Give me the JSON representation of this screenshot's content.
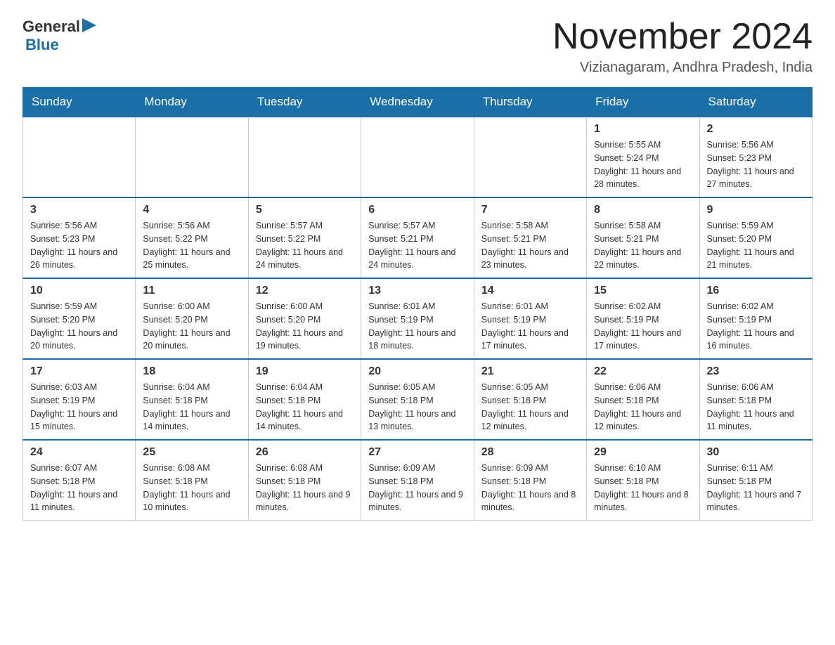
{
  "header": {
    "logo": {
      "general": "General",
      "blue": "Blue"
    },
    "title": "November 2024",
    "location": "Vizianagaram, Andhra Pradesh, India"
  },
  "weekdays": [
    "Sunday",
    "Monday",
    "Tuesday",
    "Wednesday",
    "Thursday",
    "Friday",
    "Saturday"
  ],
  "weeks": [
    [
      {
        "day": "",
        "info": ""
      },
      {
        "day": "",
        "info": ""
      },
      {
        "day": "",
        "info": ""
      },
      {
        "day": "",
        "info": ""
      },
      {
        "day": "",
        "info": ""
      },
      {
        "day": "1",
        "info": "Sunrise: 5:55 AM\nSunset: 5:24 PM\nDaylight: 11 hours and 28 minutes."
      },
      {
        "day": "2",
        "info": "Sunrise: 5:56 AM\nSunset: 5:23 PM\nDaylight: 11 hours and 27 minutes."
      }
    ],
    [
      {
        "day": "3",
        "info": "Sunrise: 5:56 AM\nSunset: 5:23 PM\nDaylight: 11 hours and 26 minutes."
      },
      {
        "day": "4",
        "info": "Sunrise: 5:56 AM\nSunset: 5:22 PM\nDaylight: 11 hours and 25 minutes."
      },
      {
        "day": "5",
        "info": "Sunrise: 5:57 AM\nSunset: 5:22 PM\nDaylight: 11 hours and 24 minutes."
      },
      {
        "day": "6",
        "info": "Sunrise: 5:57 AM\nSunset: 5:21 PM\nDaylight: 11 hours and 24 minutes."
      },
      {
        "day": "7",
        "info": "Sunrise: 5:58 AM\nSunset: 5:21 PM\nDaylight: 11 hours and 23 minutes."
      },
      {
        "day": "8",
        "info": "Sunrise: 5:58 AM\nSunset: 5:21 PM\nDaylight: 11 hours and 22 minutes."
      },
      {
        "day": "9",
        "info": "Sunrise: 5:59 AM\nSunset: 5:20 PM\nDaylight: 11 hours and 21 minutes."
      }
    ],
    [
      {
        "day": "10",
        "info": "Sunrise: 5:59 AM\nSunset: 5:20 PM\nDaylight: 11 hours and 20 minutes."
      },
      {
        "day": "11",
        "info": "Sunrise: 6:00 AM\nSunset: 5:20 PM\nDaylight: 11 hours and 20 minutes."
      },
      {
        "day": "12",
        "info": "Sunrise: 6:00 AM\nSunset: 5:20 PM\nDaylight: 11 hours and 19 minutes."
      },
      {
        "day": "13",
        "info": "Sunrise: 6:01 AM\nSunset: 5:19 PM\nDaylight: 11 hours and 18 minutes."
      },
      {
        "day": "14",
        "info": "Sunrise: 6:01 AM\nSunset: 5:19 PM\nDaylight: 11 hours and 17 minutes."
      },
      {
        "day": "15",
        "info": "Sunrise: 6:02 AM\nSunset: 5:19 PM\nDaylight: 11 hours and 17 minutes."
      },
      {
        "day": "16",
        "info": "Sunrise: 6:02 AM\nSunset: 5:19 PM\nDaylight: 11 hours and 16 minutes."
      }
    ],
    [
      {
        "day": "17",
        "info": "Sunrise: 6:03 AM\nSunset: 5:19 PM\nDaylight: 11 hours and 15 minutes."
      },
      {
        "day": "18",
        "info": "Sunrise: 6:04 AM\nSunset: 5:18 PM\nDaylight: 11 hours and 14 minutes."
      },
      {
        "day": "19",
        "info": "Sunrise: 6:04 AM\nSunset: 5:18 PM\nDaylight: 11 hours and 14 minutes."
      },
      {
        "day": "20",
        "info": "Sunrise: 6:05 AM\nSunset: 5:18 PM\nDaylight: 11 hours and 13 minutes."
      },
      {
        "day": "21",
        "info": "Sunrise: 6:05 AM\nSunset: 5:18 PM\nDaylight: 11 hours and 12 minutes."
      },
      {
        "day": "22",
        "info": "Sunrise: 6:06 AM\nSunset: 5:18 PM\nDaylight: 11 hours and 12 minutes."
      },
      {
        "day": "23",
        "info": "Sunrise: 6:06 AM\nSunset: 5:18 PM\nDaylight: 11 hours and 11 minutes."
      }
    ],
    [
      {
        "day": "24",
        "info": "Sunrise: 6:07 AM\nSunset: 5:18 PM\nDaylight: 11 hours and 11 minutes."
      },
      {
        "day": "25",
        "info": "Sunrise: 6:08 AM\nSunset: 5:18 PM\nDaylight: 11 hours and 10 minutes."
      },
      {
        "day": "26",
        "info": "Sunrise: 6:08 AM\nSunset: 5:18 PM\nDaylight: 11 hours and 9 minutes."
      },
      {
        "day": "27",
        "info": "Sunrise: 6:09 AM\nSunset: 5:18 PM\nDaylight: 11 hours and 9 minutes."
      },
      {
        "day": "28",
        "info": "Sunrise: 6:09 AM\nSunset: 5:18 PM\nDaylight: 11 hours and 8 minutes."
      },
      {
        "day": "29",
        "info": "Sunrise: 6:10 AM\nSunset: 5:18 PM\nDaylight: 11 hours and 8 minutes."
      },
      {
        "day": "30",
        "info": "Sunrise: 6:11 AM\nSunset: 5:18 PM\nDaylight: 11 hours and 7 minutes."
      }
    ]
  ]
}
